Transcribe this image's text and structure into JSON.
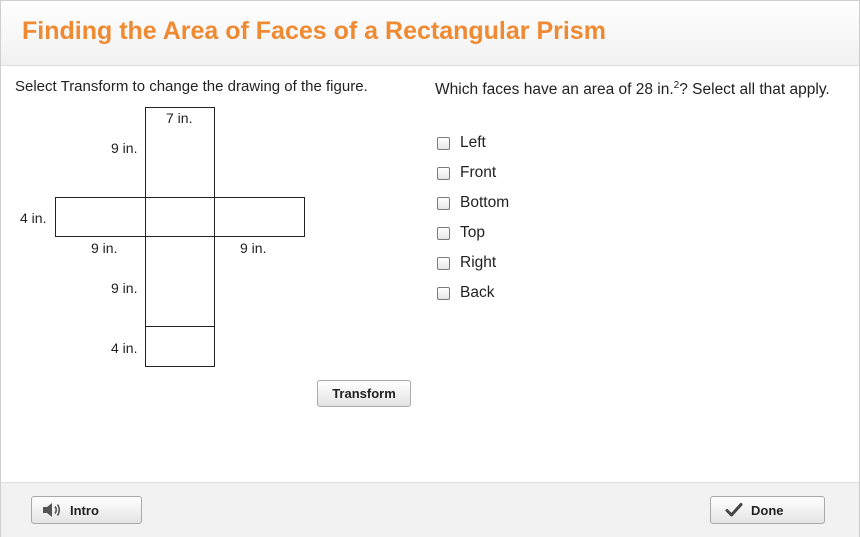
{
  "header": {
    "title": "Finding the Area of Faces of a Rectangular Prism"
  },
  "instruction": "Select Transform to change the drawing of the figure.",
  "figure": {
    "labels": {
      "top_width": "7 in.",
      "top_height": "9 in.",
      "left_height": "4 in.",
      "left_width": "9 in.",
      "right_width": "9 in.",
      "bottom_height": "9 in.",
      "last_height": "4 in."
    }
  },
  "question": {
    "prefix": "Which faces have an area of 28 in.",
    "exponent": "2",
    "suffix": "? Select all that apply."
  },
  "options": [
    "Left",
    "Front",
    "Bottom",
    "Top",
    "Right",
    "Back"
  ],
  "buttons": {
    "transform": "Transform",
    "intro": "Intro",
    "done": "Done"
  },
  "colors": {
    "title": "#f08a32"
  },
  "icons": {
    "intro": "speaker-icon",
    "done": "checkmark-icon"
  }
}
